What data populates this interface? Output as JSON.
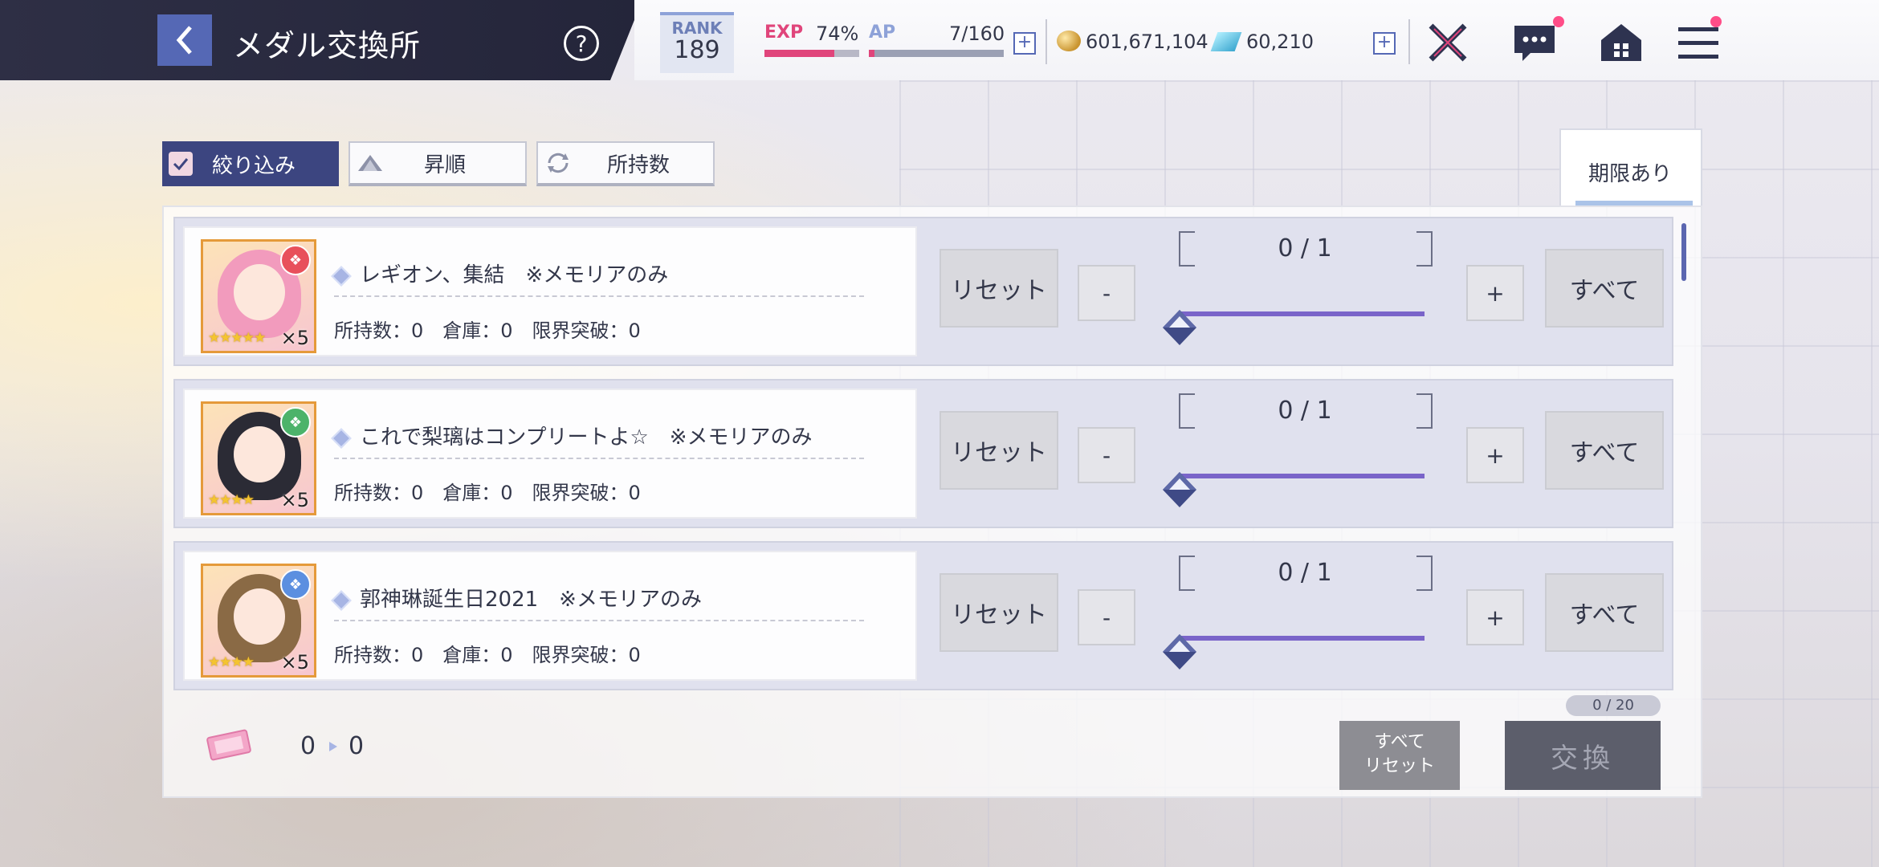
{
  "header": {
    "title": "メダル交換所",
    "help_label": "?",
    "rank_label": "RANK",
    "rank_value": "189",
    "exp_label": "EXP",
    "exp_percent": "74%",
    "exp_progress": 0.74,
    "ap_label": "AP",
    "ap_value": "7/160",
    "ap_progress": 0.044,
    "coins": "601,671,104",
    "gems": "60,210",
    "plus": "+"
  },
  "filters": {
    "filter_label": "絞り込み",
    "sort_label": "昇順",
    "sort_key_label": "所持数",
    "tab_label": "期限あり"
  },
  "items": [
    {
      "title": "レギオン、集結　※メモリアのみ",
      "stats": "所持数：0　倉庫：0　限界突破：0",
      "stars": "★★★★★",
      "count": "×5",
      "quantity": "0 / 1",
      "reset_label": "リセット",
      "minus_label": "-",
      "plus_label": "+",
      "all_label": "すべて",
      "badge_color": "#e8505b",
      "hair_color": "#f29bbd"
    },
    {
      "title": "これで梨璃はコンプリートよ☆　※メモリアのみ",
      "stats": "所持数：0　倉庫：0　限界突破：0",
      "stars": "★★★★",
      "count": "×5",
      "quantity": "0 / 1",
      "reset_label": "リセット",
      "minus_label": "-",
      "plus_label": "+",
      "all_label": "すべて",
      "badge_color": "#4cb36a",
      "hair_color": "#2b2b35"
    },
    {
      "title": "郭神琳誕生日2021　※メモリアのみ",
      "stats": "所持数：0　倉庫：0　限界突破：0",
      "stars": "★★★★",
      "count": "×5",
      "quantity": "0 / 1",
      "reset_label": "リセット",
      "minus_label": "-",
      "plus_label": "+",
      "all_label": "すべて",
      "badge_color": "#5b8fe0",
      "hair_color": "#8a6a45"
    }
  ],
  "footer": {
    "from_value": "0",
    "to_value": "0",
    "reset_all_line1": "すべて",
    "reset_all_line2": "リセット",
    "exchange_count": "0 / 20",
    "exchange_label": "交換"
  },
  "colors": {
    "accent": "#3c4580",
    "slider": "#7a64c9",
    "exp": "#e0457b"
  },
  "icons": [
    "back-icon",
    "help-icon",
    "coin-icon",
    "gem-icon",
    "battle-icon",
    "chat-icon",
    "home-icon",
    "menu-icon",
    "check-icon",
    "sort-icon",
    "refresh-icon",
    "ticket-icon"
  ]
}
